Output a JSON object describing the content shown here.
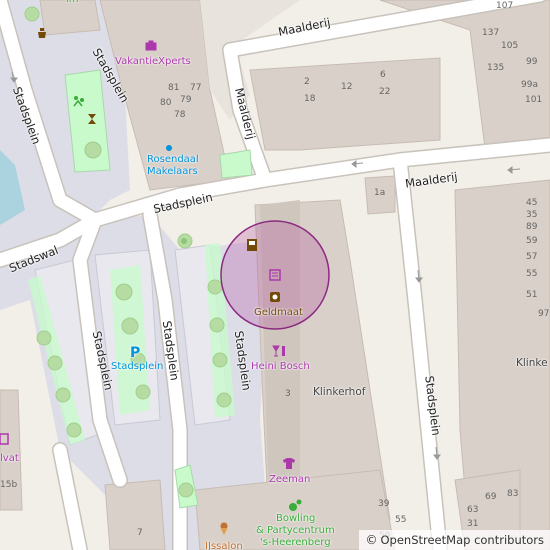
{
  "streets": {
    "maalderij_top": "Maalderij",
    "maalderij_vertical": "Maalderij",
    "maalderij_right": "Maalderij",
    "stadsplein_top_left": "Stadsplein",
    "stadsplein_left_edge": "Stadsplein",
    "stadsplein_road": "Stadsplein",
    "stadswal": "Stadswal",
    "stadsplein_left_block": "Stadsplein",
    "stadsplein_mid_block": "Stadsplein",
    "stadsplein_right_block": "Stadsplein",
    "stadsplein_right_road": "Stadsplein"
  },
  "pois": {
    "vakantiexperts": "VakantieXperts",
    "makelaars_line1": "Rosendaal",
    "makelaars_line2": "Makelaars",
    "parking_label": "Stadsplein",
    "geldmaat": "Geldmaat",
    "heini_bosch": "Heini Bosch",
    "klinkerhof": "Klinkerhof",
    "zeeman": "Zeeman",
    "bowling_line1": "Bowling",
    "bowling_line2": "& Partycentrum",
    "bowling_line3": "'s-Heerenberg",
    "issalon": "IJssalon",
    "lvat": "lvat",
    "top_left_cut": "lm",
    "parking_symbol": "P"
  },
  "house_numbers": [
    "81",
    "77",
    "79",
    "80",
    "78",
    "2",
    "6",
    "12",
    "22",
    "18",
    "1a",
    "3",
    "39",
    "55",
    "59",
    "7",
    "15b",
    "107",
    "137",
    "105",
    "99",
    "135",
    "99a",
    "101",
    "45",
    "35",
    "89",
    "59",
    "57",
    "55",
    "51",
    "97",
    "69",
    "83",
    "63",
    "31"
  ],
  "colors": {
    "background": "#f2efe9",
    "pedestrian": "#dddde8",
    "building": "#d9d0c9",
    "road": "#ffffff",
    "road_casing": "#c8c2bb",
    "park": "#c8facc",
    "poi_pink": "#ac39ac",
    "poi_blue": "#0092da",
    "poi_brown": "#734a08",
    "poi_green": "#39ac39",
    "highlight_fill": "rgba(180,80,160,0.30)",
    "highlight_stroke": "#8b2a82"
  },
  "attribution": {
    "symbol": "©",
    "text": "OpenStreetMap contributors"
  }
}
